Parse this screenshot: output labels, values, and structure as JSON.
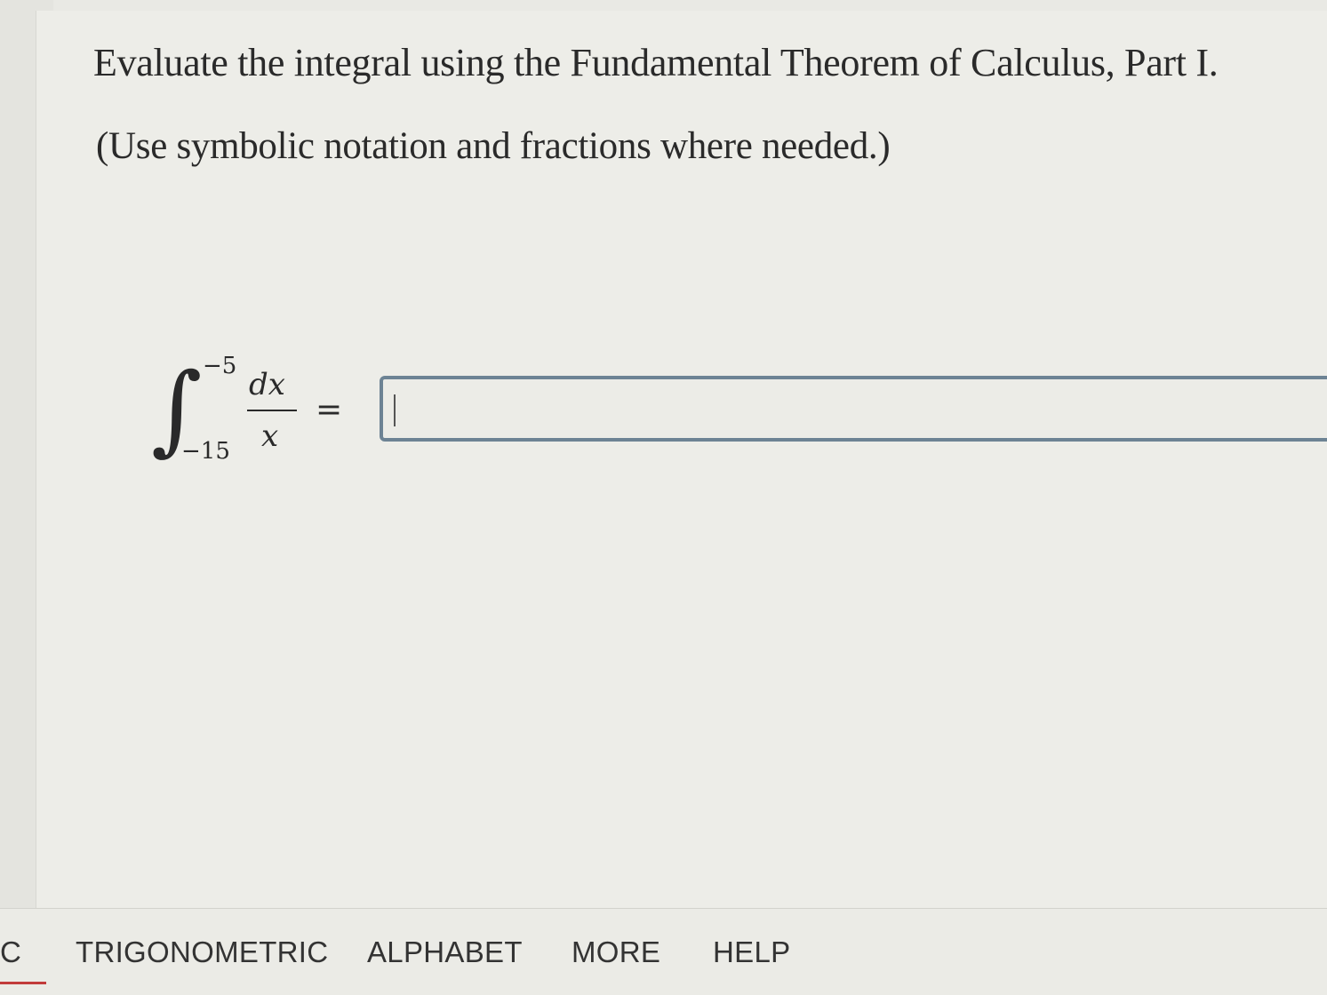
{
  "question": {
    "prompt": "Evaluate the integral using the Fundamental Theorem of Calculus, Part I.",
    "instruction": "(Use symbolic notation and fractions where needed.)"
  },
  "expression": {
    "integral_symbol": "∫",
    "upper_limit": "−5",
    "lower_limit": "−15",
    "numerator": "dx",
    "denominator": "x",
    "equals": "="
  },
  "answer": {
    "value": ""
  },
  "toolbar": {
    "tabs": [
      {
        "label": "C"
      },
      {
        "label": "TRIGONOMETRIC"
      },
      {
        "label": "ALPHABET"
      },
      {
        "label": "MORE"
      },
      {
        "label": "HELP"
      }
    ],
    "active_underline_color": "#c23b3b"
  },
  "colors": {
    "input_border": "#6d8394",
    "text": "#2a2a2a"
  }
}
